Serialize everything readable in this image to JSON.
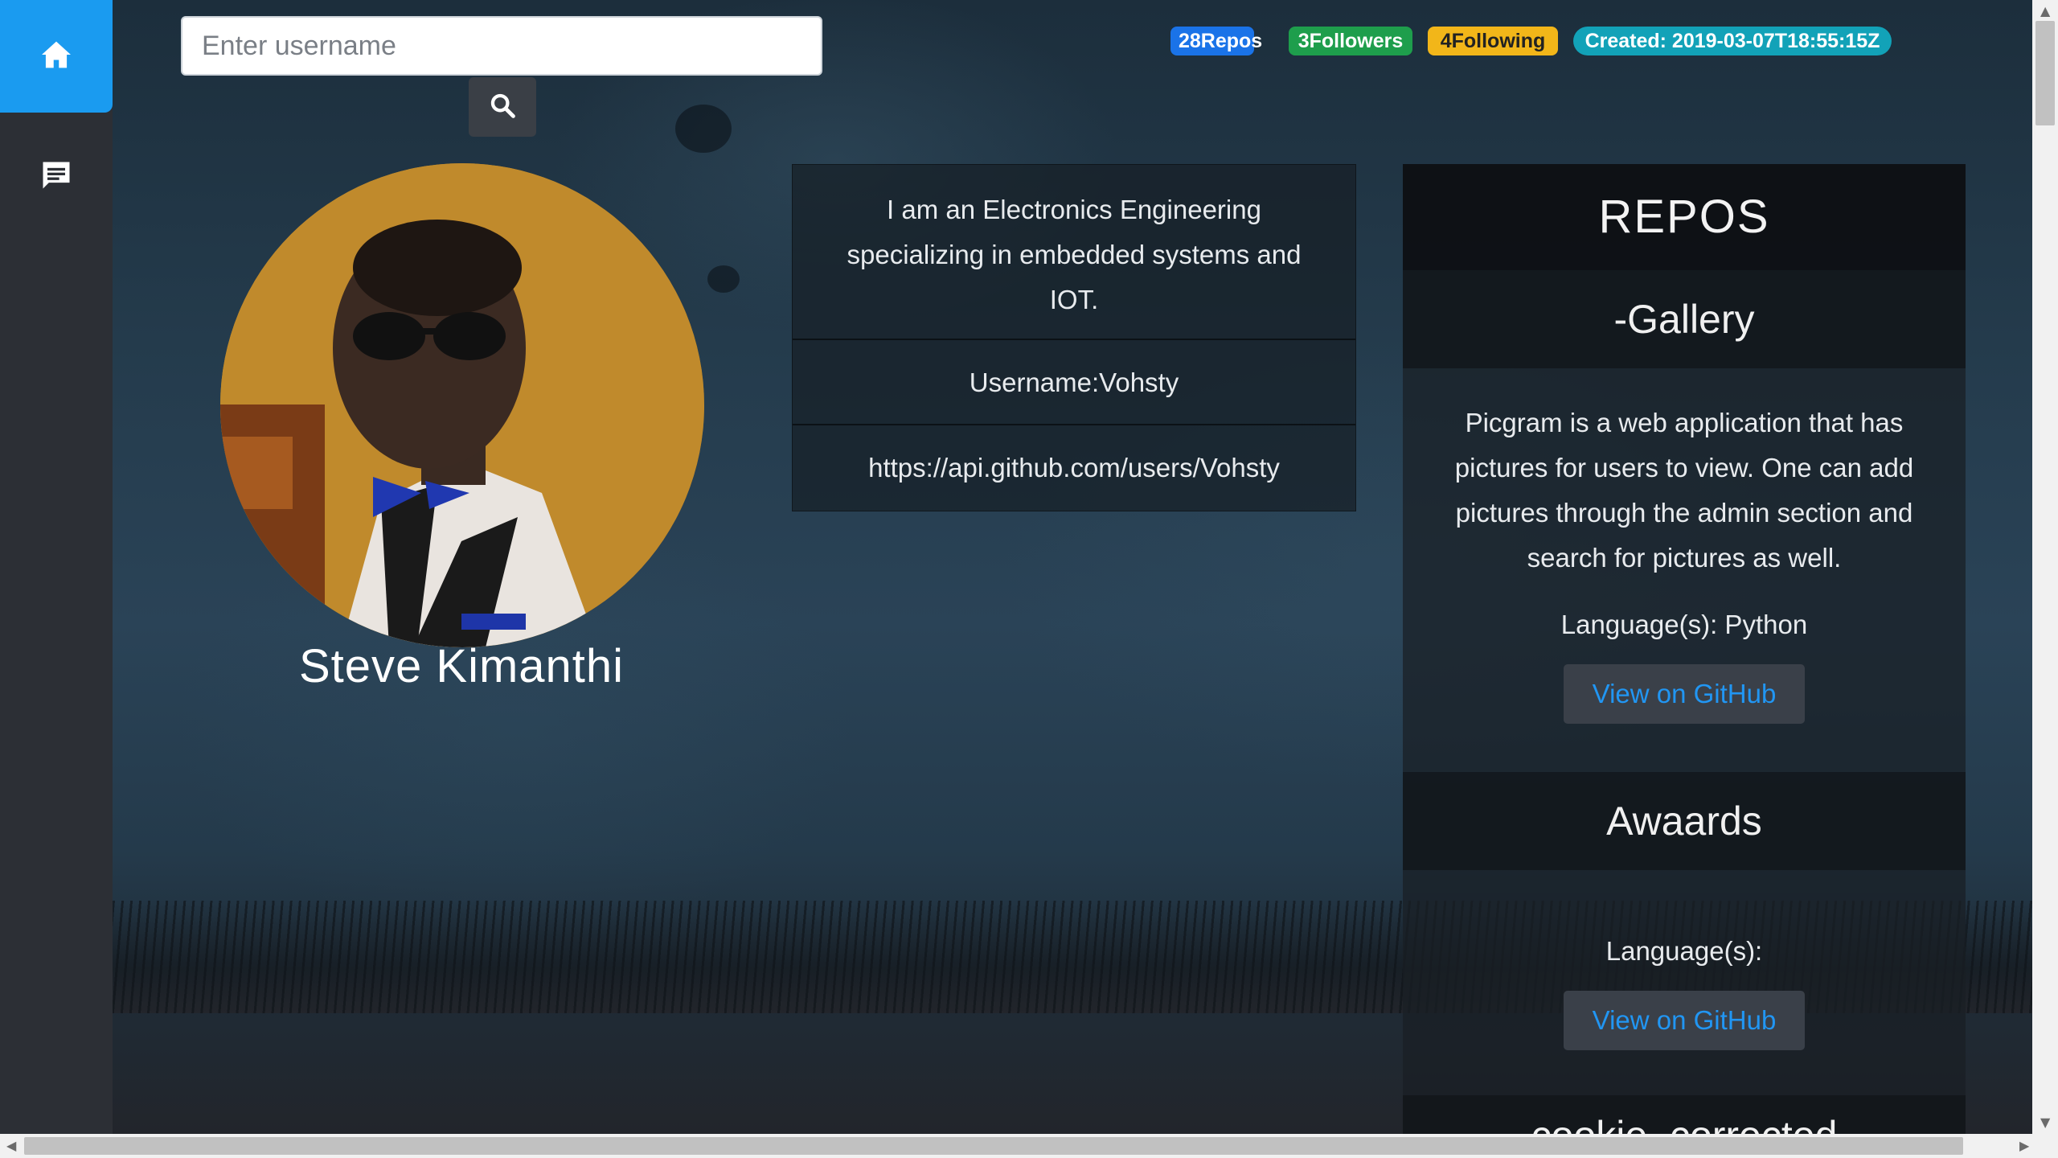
{
  "sidebar": {
    "items": [
      {
        "name": "home",
        "icon": "home-icon",
        "active": true
      },
      {
        "name": "messages",
        "icon": "chat-icon",
        "active": false
      }
    ]
  },
  "search": {
    "placeholder": "Enter username",
    "value": "",
    "button_icon": "search-icon"
  },
  "stats": {
    "repos": "28Repos",
    "followers": "3Followers",
    "following": "4Following",
    "created": "Created: 2019-03-07T18:55:15Z"
  },
  "profile": {
    "name": "Steve Kimanthi",
    "bio": "I am an Electronics Engineering specializing in embedded systems and IOT.",
    "username": "Username:Vohsty",
    "url": "https://api.github.com/users/Vohsty"
  },
  "repos": {
    "header": "REPOS",
    "items": [
      {
        "title": "-Gallery",
        "description": "Picgram is a web application that has pictures for users to view. One can add pictures through the admin section and search for pictures as well.",
        "language": "Language(s): Python",
        "button": "View on GitHub"
      },
      {
        "title": "Awaards",
        "description": "",
        "language": "Language(s):",
        "button": "View on GitHub"
      },
      {
        "title": "cookie_corrected"
      }
    ]
  },
  "colors": {
    "accent": "#1a9bf0",
    "badge_repos": "#1a73e8",
    "badge_followers": "#1e9e4c",
    "badge_following": "#f2b619",
    "badge_created": "#12a2b8",
    "link": "#2196f3"
  }
}
